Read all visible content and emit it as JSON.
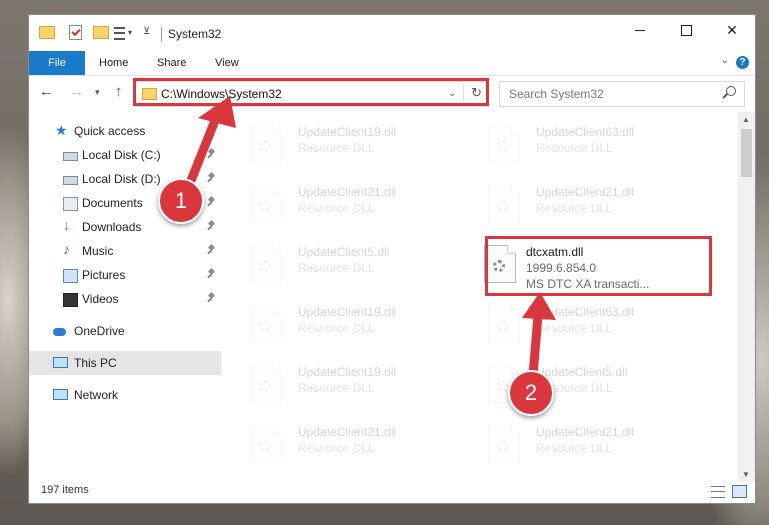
{
  "window": {
    "title": "System32"
  },
  "ribbon": {
    "tabs": [
      "File",
      "Home",
      "Share",
      "View"
    ],
    "help": "?"
  },
  "nav": {
    "address": "C:\\Windows\\System32",
    "search_placeholder": "Search System32"
  },
  "sidebar": {
    "items": [
      {
        "label": "Quick access",
        "icon": "star-icon",
        "pinned": false
      },
      {
        "label": "Local Disk (C:)",
        "icon": "drive-icon",
        "pinned": true
      },
      {
        "label": "Local Disk (D:)",
        "icon": "drive-icon",
        "pinned": true
      },
      {
        "label": "Documents",
        "icon": "documents-icon",
        "pinned": true
      },
      {
        "label": "Downloads",
        "icon": "download-icon",
        "pinned": true
      },
      {
        "label": "Music",
        "icon": "music-icon",
        "pinned": true
      },
      {
        "label": "Pictures",
        "icon": "pictures-icon",
        "pinned": true
      },
      {
        "label": "Videos",
        "icon": "videos-icon",
        "pinned": true
      },
      {
        "label": "OneDrive",
        "icon": "cloud-icon",
        "pinned": false
      },
      {
        "label": "This PC",
        "icon": "computer-icon",
        "pinned": false,
        "selected": true
      },
      {
        "label": "Network",
        "icon": "network-icon",
        "pinned": false
      }
    ]
  },
  "files": [
    {
      "name": "UpdateClient19.dll",
      "sub": "Resource DLL"
    },
    {
      "name": "UpdateClient63.dll",
      "sub": "Resource DLL"
    },
    {
      "name": "UpdateClient21.dll",
      "sub": "Resource DLL"
    },
    {
      "name": "UpdateClient21.dll",
      "sub": "Resource DLL"
    },
    {
      "name": "UpdateClient5.dll",
      "sub": "Resource DLL"
    },
    {
      "name": "dtcxatm.dll",
      "sub": "1999.6.854.0",
      "sub2": "MS DTC XA transacti...",
      "highlight": true
    },
    {
      "name": "UpdateClient19.dll",
      "sub": "Resource DLL"
    },
    {
      "name": "UpdateClient63.dll",
      "sub": "Resource DLL"
    },
    {
      "name": "UpdateClient19.dll",
      "sub": "Resource DLL"
    },
    {
      "name": "UpdateClient5.dll",
      "sub": "Resource DLL"
    },
    {
      "name": "UpdateClient21.dll",
      "sub": "Resource DLL"
    },
    {
      "name": "UpdateClient21.dll",
      "sub": "Resource DLL"
    }
  ],
  "status": {
    "count": "197 items"
  },
  "annotations": {
    "badge1": "1",
    "badge2": "2",
    "color": "#d9363e"
  }
}
